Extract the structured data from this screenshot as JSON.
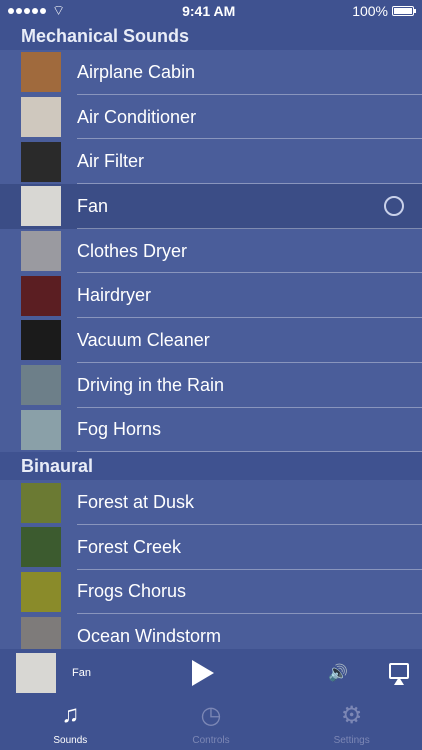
{
  "status": {
    "time": "9:41 AM",
    "battery": "100%"
  },
  "sections": [
    {
      "title": "Mechanical Sounds",
      "items": [
        {
          "label": "Airplane Cabin",
          "thumb": "#a06a3d"
        },
        {
          "label": "Air Conditioner",
          "thumb": "#cfc8be"
        },
        {
          "label": "Air Filter",
          "thumb": "#2a2a2a"
        },
        {
          "label": "Fan",
          "thumb": "#d8d7d3",
          "selected": true,
          "icon": "fan-icon"
        },
        {
          "label": "Clothes Dryer",
          "thumb": "#9a9aa0"
        },
        {
          "label": "Hairdryer",
          "thumb": "#5b1e22"
        },
        {
          "label": "Vacuum Cleaner",
          "thumb": "#1b1b1b"
        },
        {
          "label": "Driving in the Rain",
          "thumb": "#6d7f89"
        },
        {
          "label": "Fog Horns",
          "thumb": "#8aa0a8"
        }
      ]
    },
    {
      "title": "Binaural",
      "items": [
        {
          "label": "Forest at Dusk",
          "thumb": "#6b7a33"
        },
        {
          "label": "Forest Creek",
          "thumb": "#3c5b2f"
        },
        {
          "label": "Frogs Chorus",
          "thumb": "#8a8b2a"
        },
        {
          "label": "Ocean Windstorm",
          "thumb": "#7e7b7a"
        }
      ]
    }
  ],
  "player": {
    "title": "Fan",
    "thumb": "#d8d7d3"
  },
  "tabs": [
    {
      "label": "Sounds",
      "icon": "music-note-icon",
      "active": true
    },
    {
      "label": "Controls",
      "icon": "stopwatch-icon",
      "active": false
    },
    {
      "label": "Settings",
      "icon": "gear-icon",
      "active": false
    }
  ]
}
